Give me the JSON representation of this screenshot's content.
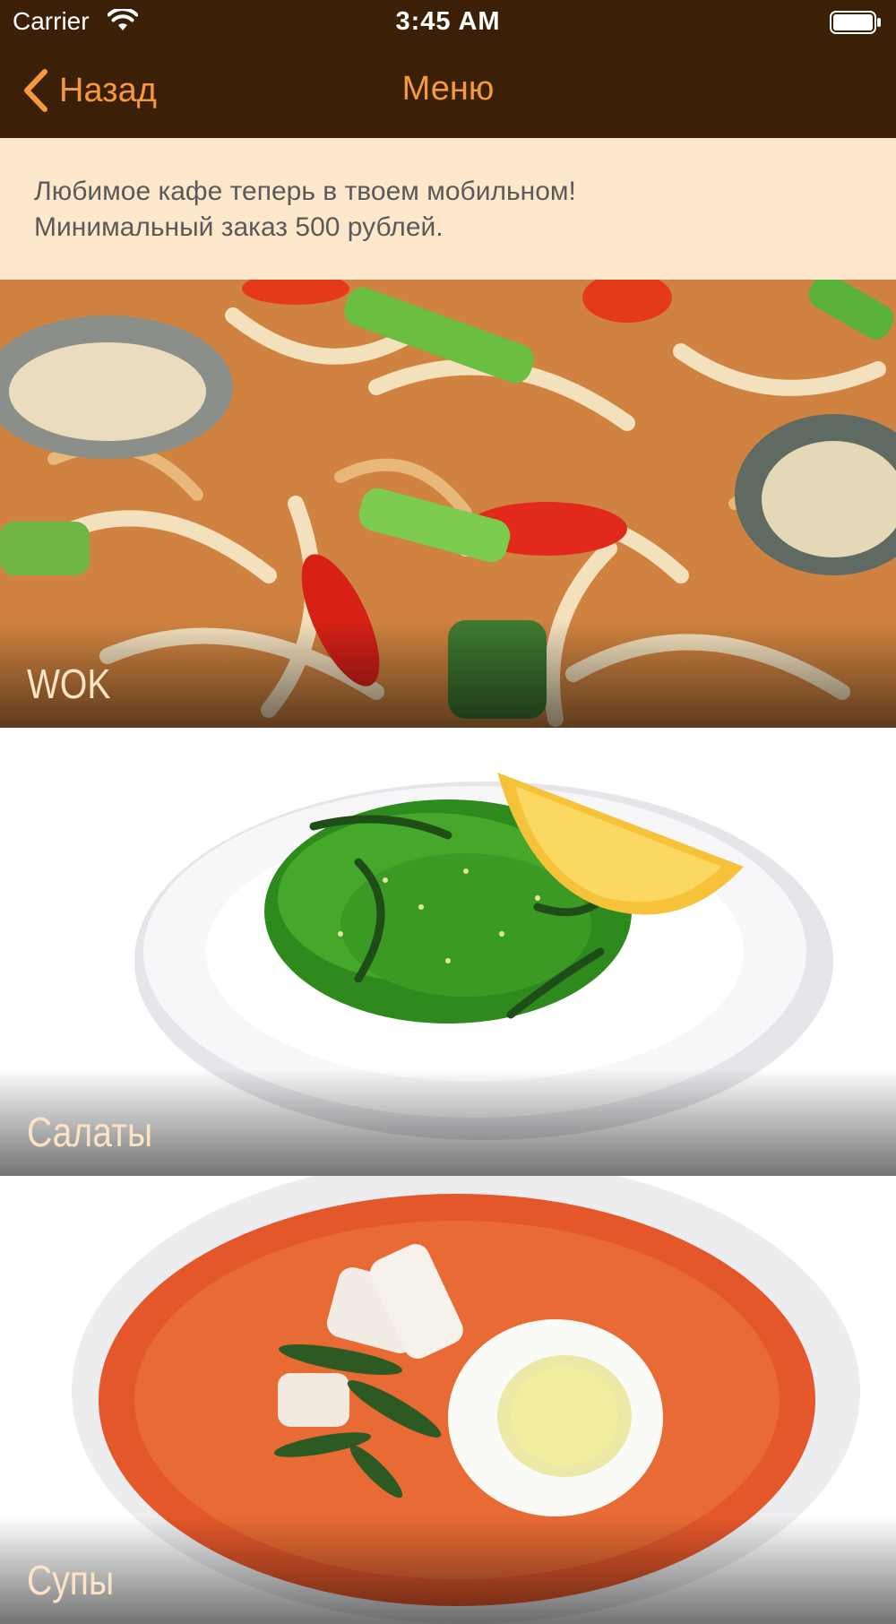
{
  "status_bar": {
    "carrier": "Carrier",
    "time": "3:45 AM",
    "icons": [
      "wifi-icon",
      "battery-icon"
    ]
  },
  "nav": {
    "back_label": "Назад",
    "title": "Меню",
    "back_icon": "chevron-left-icon"
  },
  "banner": {
    "line1": "Любимое кафе теперь в твоем мобильном!",
    "line2": "Минимальный заказ 500 рублей."
  },
  "categories": [
    {
      "label": "WOK"
    },
    {
      "label": "Салаты"
    },
    {
      "label": "Супы"
    }
  ],
  "colors": {
    "bar": "#3b1f06",
    "accent": "#f59a3c",
    "banner_bg": "#fde8cc",
    "banner_text": "#5a5a5a",
    "category_label": "#fbe3c6"
  }
}
